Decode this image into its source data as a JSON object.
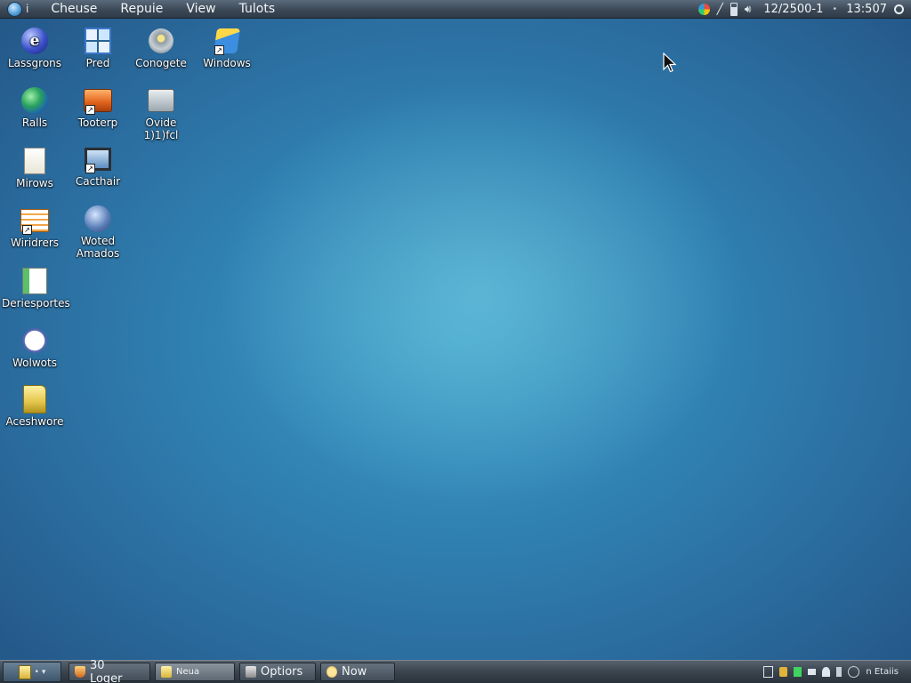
{
  "top_panel": {
    "menu": [
      "Cheuse",
      "Repuie",
      "View",
      "Tulots"
    ],
    "clock_date": "12/2500-1",
    "clock_time": "13:507",
    "info_glyph": "i"
  },
  "desktop_icons": [
    {
      "label": "Lassgrons",
      "icon": "globe-e-icon"
    },
    {
      "label": "Pred",
      "icon": "windows-grid-icon"
    },
    {
      "label": "Conogete",
      "icon": "drive-icon"
    },
    {
      "label": "Windows",
      "icon": "folder-blue-icon"
    },
    {
      "label": "Ralls",
      "icon": "earth-icon"
    },
    {
      "label": "Tooterp",
      "icon": "toolbox-icon"
    },
    {
      "label": "Ovide 1)1)fcl",
      "icon": "printer-icon"
    },
    {
      "label": "Mirows",
      "icon": "document-icon"
    },
    {
      "label": "Cacthair",
      "icon": "monitor-icon"
    },
    {
      "label": "Wiridrers",
      "icon": "notes-icon"
    },
    {
      "label": "Woted Amados",
      "icon": "satellite-icon"
    },
    {
      "label": "Deriesportes",
      "icon": "spreadsheet-icon"
    },
    {
      "label": "Wolwots",
      "icon": "clock-icon"
    },
    {
      "label": "Aceshwore",
      "icon": "folder-icon"
    }
  ],
  "taskbar": {
    "start_label": "• ▾",
    "buttons": [
      {
        "label": "30 Loger",
        "icon": "shield-icon"
      },
      {
        "label": "Neua",
        "icon": "folder-icon",
        "active": true
      },
      {
        "label": "Optiors",
        "icon": "wrench-icon"
      },
      {
        "label": "Now",
        "icon": "face-icon"
      }
    ],
    "tray_text": "n Etaiis"
  },
  "colors": {
    "desktop_center": "#3d9ec9",
    "desktop_edge": "#24598a",
    "panel": "#3b4856"
  }
}
